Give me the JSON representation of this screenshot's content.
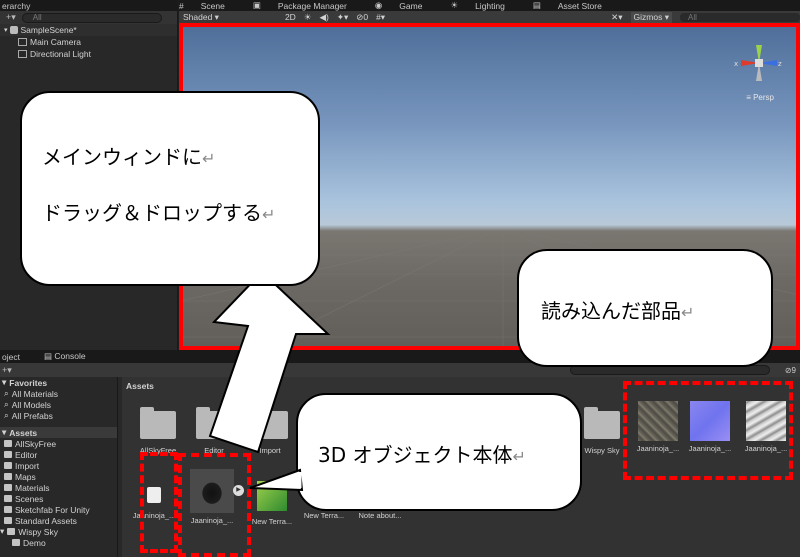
{
  "hierarchy": {
    "tab_label": "erarchy",
    "search_placeholder": "All",
    "items": [
      "SampleScene*",
      "Main Camera",
      "Directional Light"
    ]
  },
  "scene": {
    "tabs": [
      "Scene",
      "Package Manager",
      "Game",
      "Lighting",
      "Asset Store"
    ],
    "shading": "Shaded",
    "mode_2d": "2D",
    "fx_count": "0",
    "gizmos": "Gizmos",
    "search_placeholder": "All",
    "persp_label": "Persp",
    "gizmo_x": "x",
    "gizmo_z": "z"
  },
  "project": {
    "tabs": [
      "oject",
      "Console"
    ],
    "layers_count": "9",
    "favorites_header": "Favorites",
    "favorites": [
      "All Materials",
      "All Models",
      "All Prefabs"
    ],
    "assets_header": "Assets",
    "assets_tree": [
      "AllSkyFree",
      "Editor",
      "Import",
      "Maps",
      "Materials",
      "Scenes",
      "Sketchfab For Unity",
      "Standard Assets",
      "Wispy Sky",
      "Demo"
    ],
    "breadcrumb": "Assets",
    "folders_row": [
      "AllSkyFree",
      "Editor",
      "Import",
      "Wispy Sky"
    ],
    "textures": [
      "Jaaninoja_...",
      "Jaaninoja_...",
      "Jaaninoja_..."
    ],
    "bottom_row": [
      "Jaaninoja_...",
      "Jaaninoja_...",
      "New Terra...",
      "New Terra...",
      "Note about..."
    ]
  },
  "callouts": {
    "drag_line1": "メインウィンドに",
    "drag_line2": "ドラッグ＆ドロップする",
    "parts": "読み込んだ部品",
    "object": "3D オブジェクト本体",
    "return_mark": "↵"
  },
  "colors": {
    "highlight": "#ff0000",
    "sky": "#7795bd",
    "ground": "#6c6864"
  }
}
